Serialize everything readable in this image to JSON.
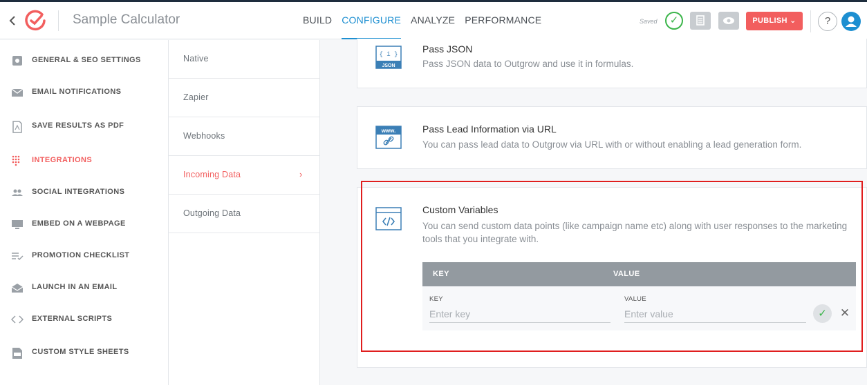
{
  "header": {
    "app_title": "Sample Calculator",
    "nav": [
      "BUILD",
      "CONFIGURE",
      "ANALYZE",
      "PERFORMANCE"
    ],
    "active_nav": "CONFIGURE",
    "saved_label": "Saved",
    "publish_label": "PUBLISH",
    "help_label": "?"
  },
  "sidebar": {
    "items": [
      {
        "label": "GENERAL & SEO SETTINGS",
        "icon": "gear-icon"
      },
      {
        "label": "EMAIL NOTIFICATIONS",
        "icon": "envelope-icon"
      },
      {
        "label": "SAVE RESULTS AS PDF",
        "icon": "pdf-icon"
      },
      {
        "label": "INTEGRATIONS",
        "icon": "grid-dots-icon"
      },
      {
        "label": "SOCIAL INTEGRATIONS",
        "icon": "people-icon"
      },
      {
        "label": "EMBED ON A WEBPAGE",
        "icon": "monitor-icon"
      },
      {
        "label": "PROMOTION CHECKLIST",
        "icon": "checklist-icon"
      },
      {
        "label": "LAUNCH IN AN EMAIL",
        "icon": "open-envelope-icon"
      },
      {
        "label": "EXTERNAL SCRIPTS",
        "icon": "code-icon"
      },
      {
        "label": "CUSTOM STYLE SHEETS",
        "icon": "css-file-icon"
      }
    ],
    "active": "INTEGRATIONS"
  },
  "submenu": {
    "items": [
      "Native",
      "Zapier",
      "Webhooks",
      "Incoming Data",
      "Outgoing Data"
    ],
    "active": "Incoming Data"
  },
  "cards": {
    "json": {
      "title": "Pass JSON",
      "desc": "Pass JSON data to Outgrow and use it in formulas.",
      "icon_text": "JSON",
      "icon_brace": "{ i }"
    },
    "url": {
      "title": "Pass Lead Information via URL",
      "desc": "You can pass lead data to Outgrow via URL with or without enabling a lead generation form.",
      "icon_text": "www."
    },
    "custom": {
      "title": "Custom Variables",
      "desc": "You can send custom data points (like campaign name etc) along with user responses to the marketing tools that you integrate with."
    }
  },
  "kv_table": {
    "key_header": "KEY",
    "value_header": "VALUE",
    "key_label": "KEY",
    "value_label": "VALUE",
    "key_placeholder": "Enter key",
    "value_placeholder": "Enter value"
  },
  "colors": {
    "accent": "#1d8fd1",
    "brand_red": "#f25e5e",
    "success": "#3bb54a",
    "highlight_border": "#e01e1e"
  }
}
